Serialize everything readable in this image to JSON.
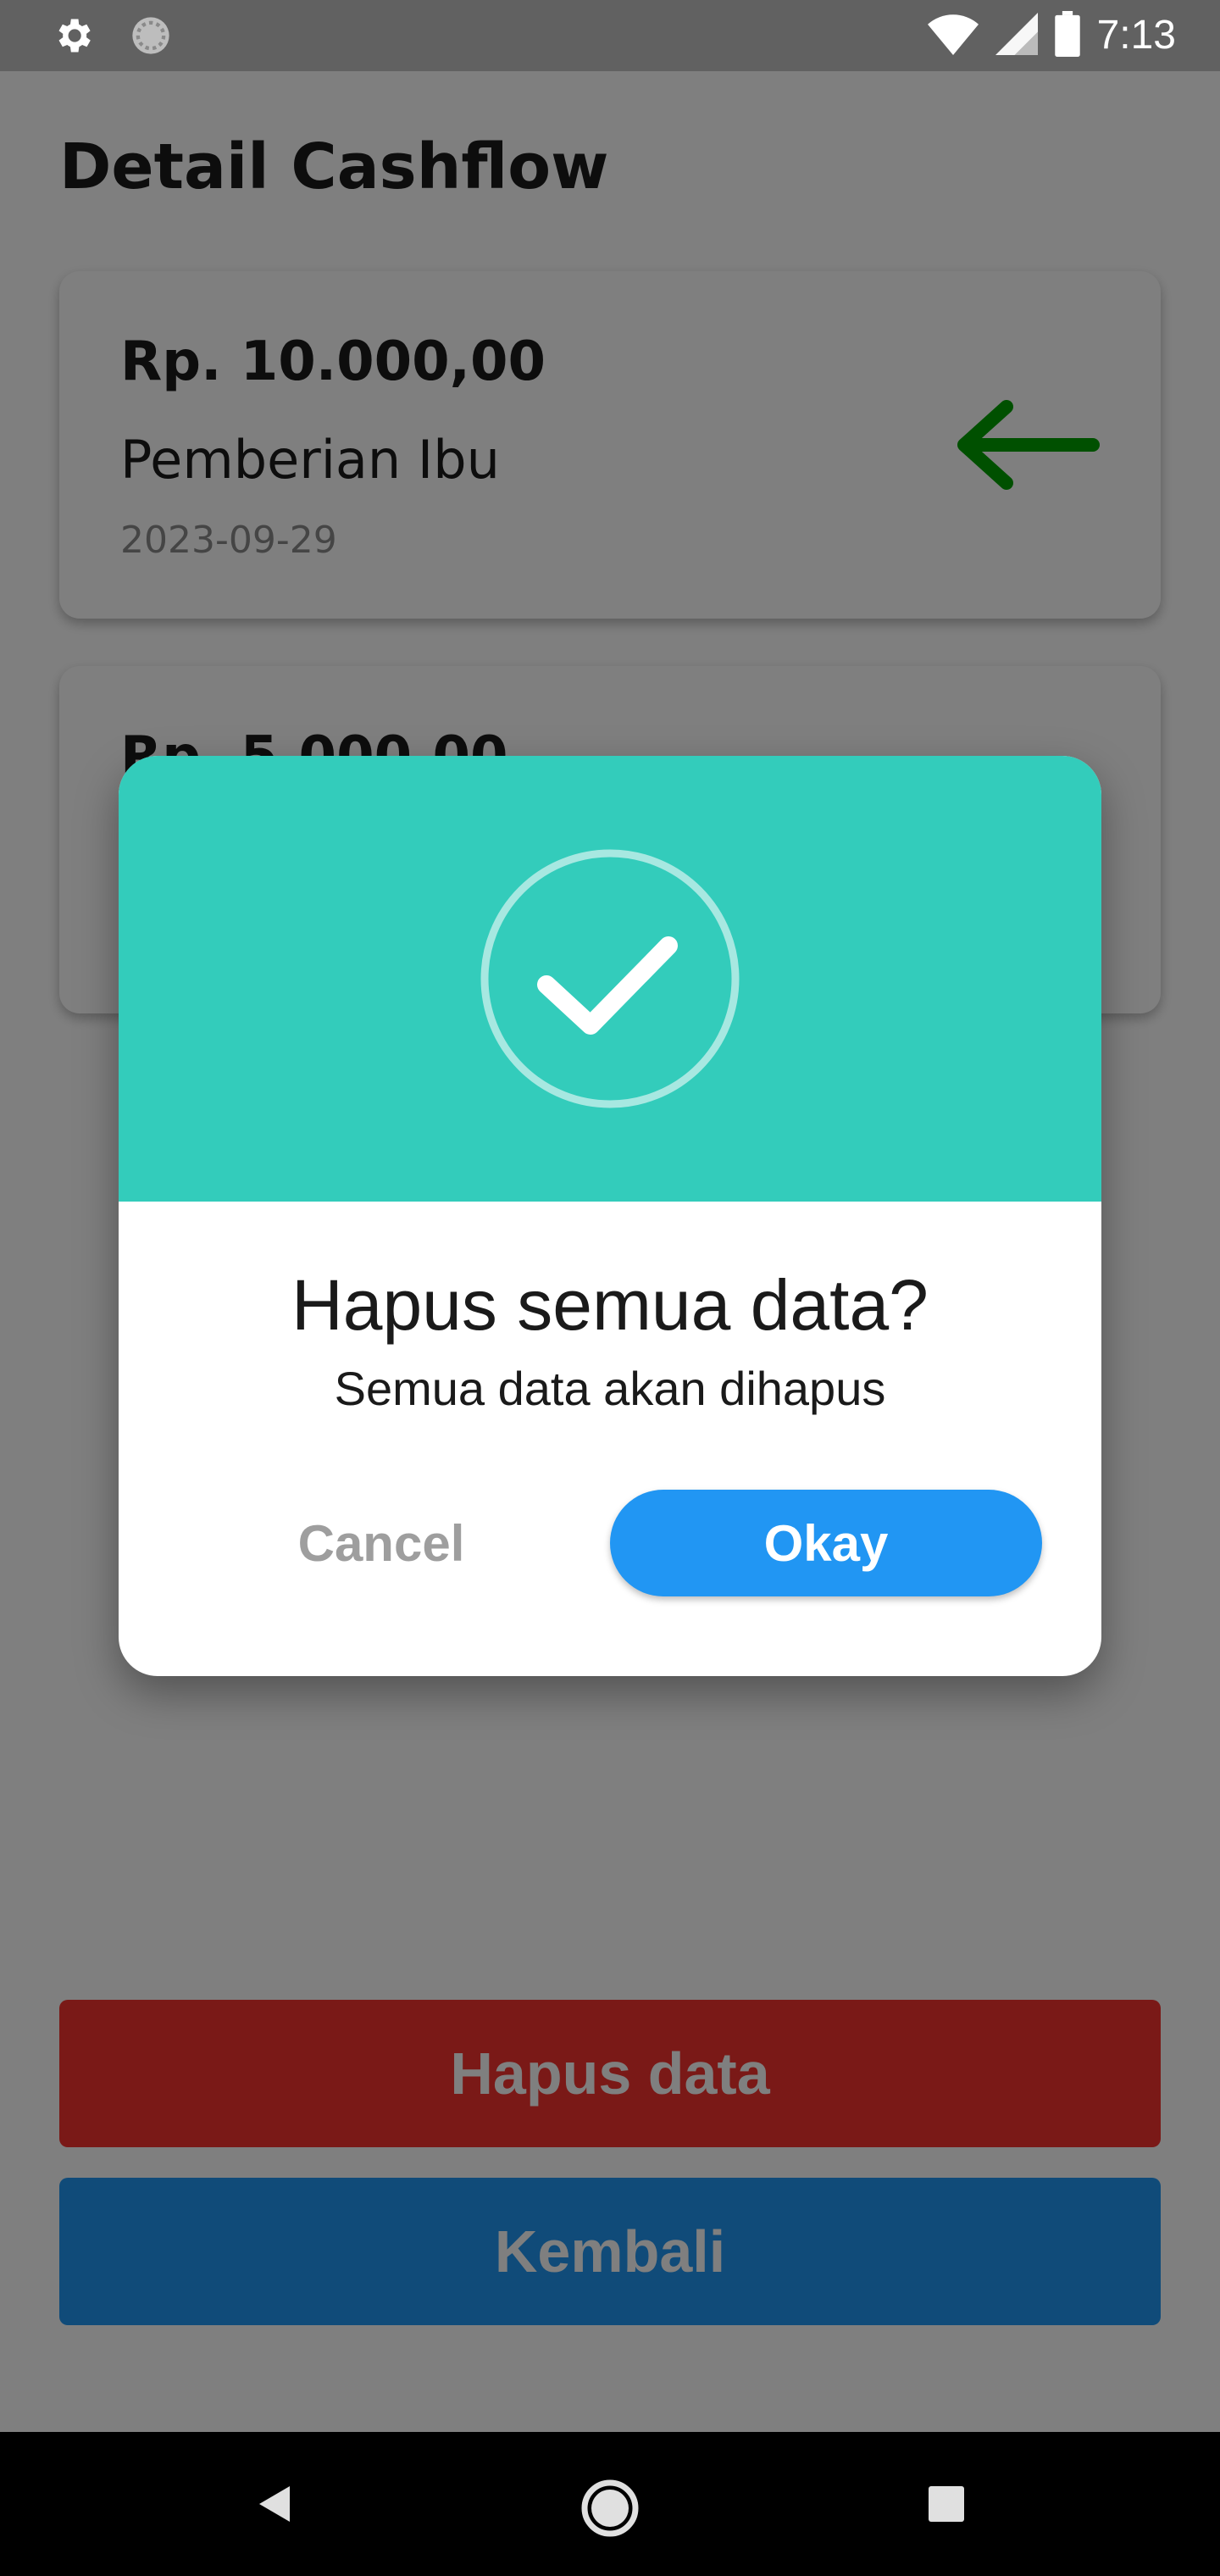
{
  "status_bar": {
    "time": "7:13",
    "icons": [
      "gear-icon",
      "sync-icon",
      "wifi-icon",
      "cell-signal-icon",
      "battery-icon"
    ]
  },
  "page": {
    "title": "Detail Cashflow"
  },
  "cashflow_items": [
    {
      "amount": "Rp. 10.000,00",
      "description": "Pemberian Ibu",
      "date": "2023-09-29",
      "direction_icon": "arrow-left-icon",
      "direction_color": "#00a000"
    },
    {
      "amount": "Rp. 5.000,00"
    }
  ],
  "actions": {
    "delete_label": "Hapus data",
    "delete_color": "#f5322f",
    "back_label": "Kembali",
    "back_color": "#2196f3"
  },
  "dialog": {
    "icon": "check-circle-icon",
    "header_color": "#33ccbb",
    "title": "Hapus semua data?",
    "message": "Semua data akan dihapus",
    "cancel_label": "Cancel",
    "okay_label": "Okay",
    "okay_color": "#2196f3"
  },
  "nav_bar": {
    "buttons": [
      "back-icon",
      "home-icon",
      "recents-icon"
    ]
  }
}
